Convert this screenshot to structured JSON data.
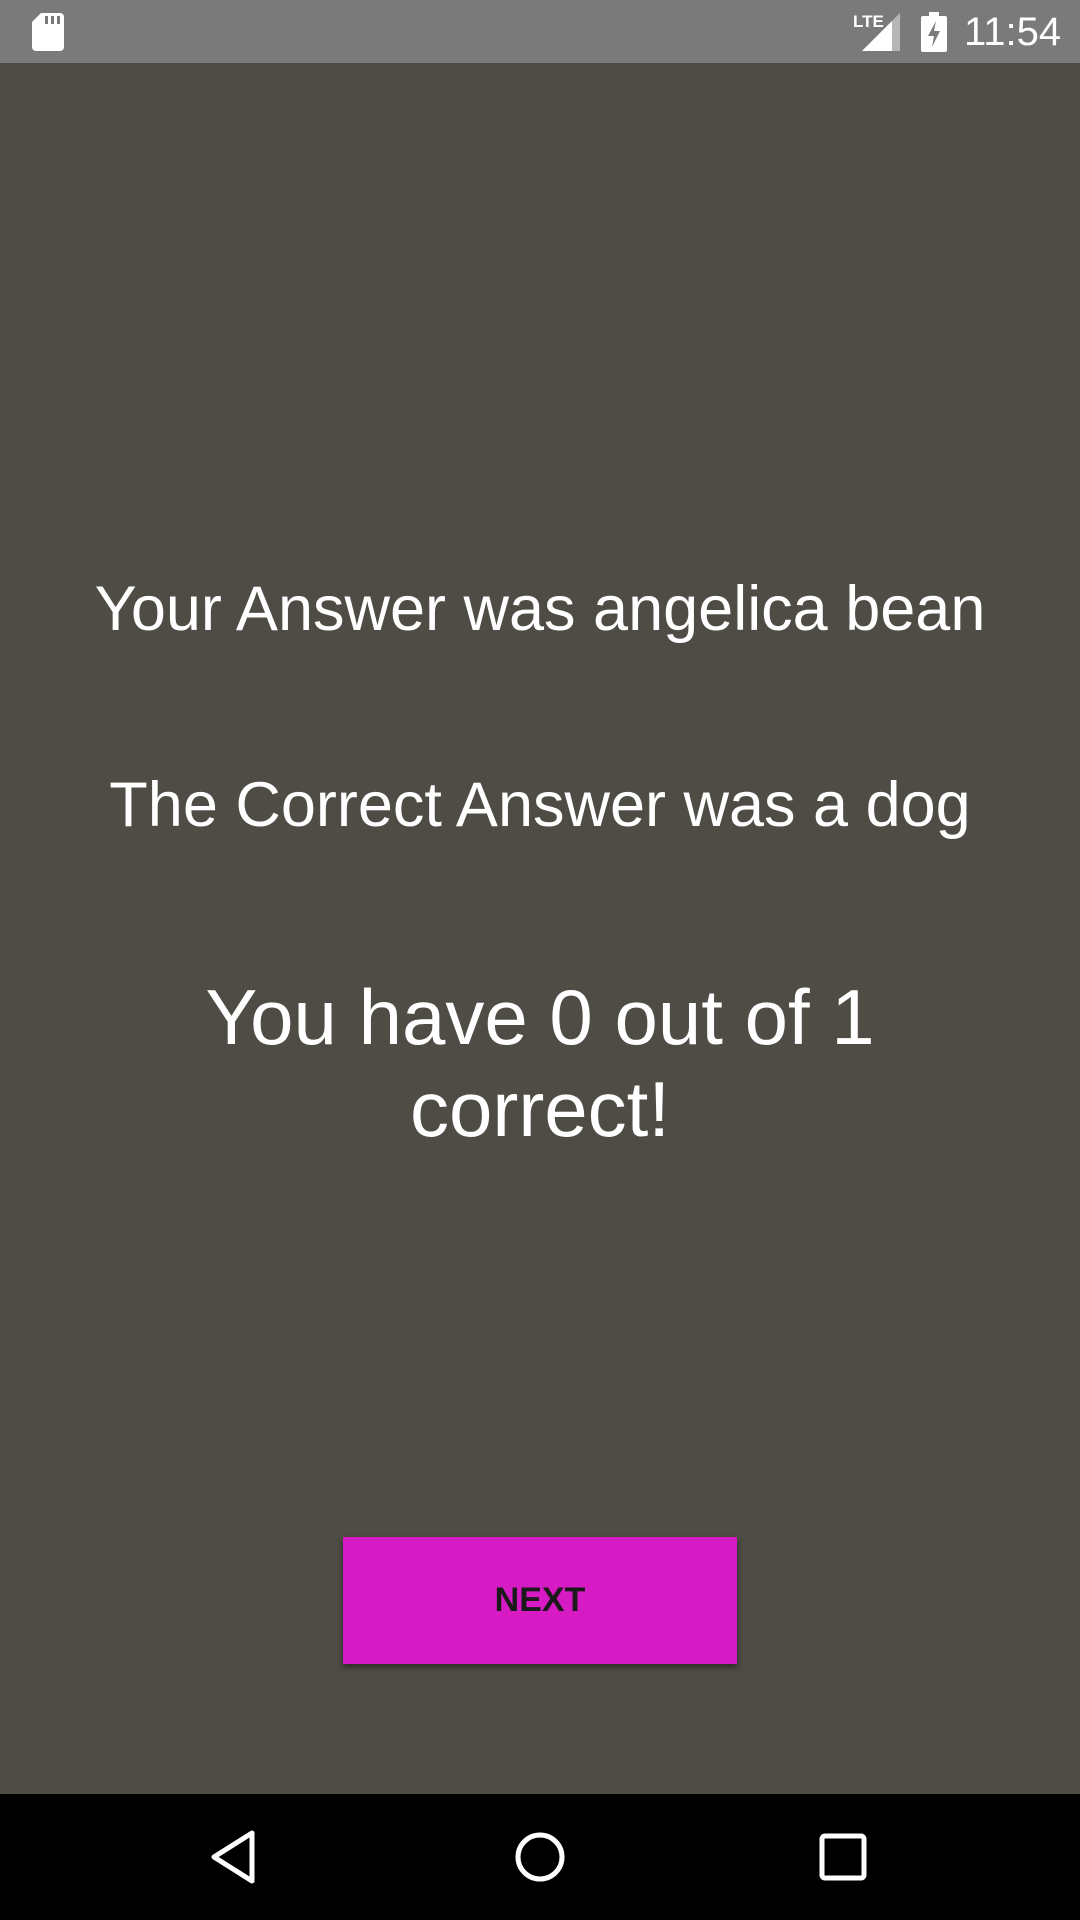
{
  "status_bar": {
    "network": "LTE",
    "time": "11:54",
    "icons": [
      "sd-card-icon",
      "signal-icon",
      "battery-charging-icon"
    ]
  },
  "result": {
    "your_answer": "Your Answer was angelica bean",
    "correct_answer": "The Correct Answer was a dog",
    "score": "You have 0 out of 1 correct!"
  },
  "actions": {
    "next_label": "NEXT"
  },
  "nav": {
    "icons": [
      "back-icon",
      "home-icon",
      "recent-apps-icon"
    ]
  },
  "colors": {
    "background": "#4e4c45",
    "status_bar": "#7a7a7a",
    "accent": "#d61bc5",
    "nav_bar": "#000000"
  }
}
